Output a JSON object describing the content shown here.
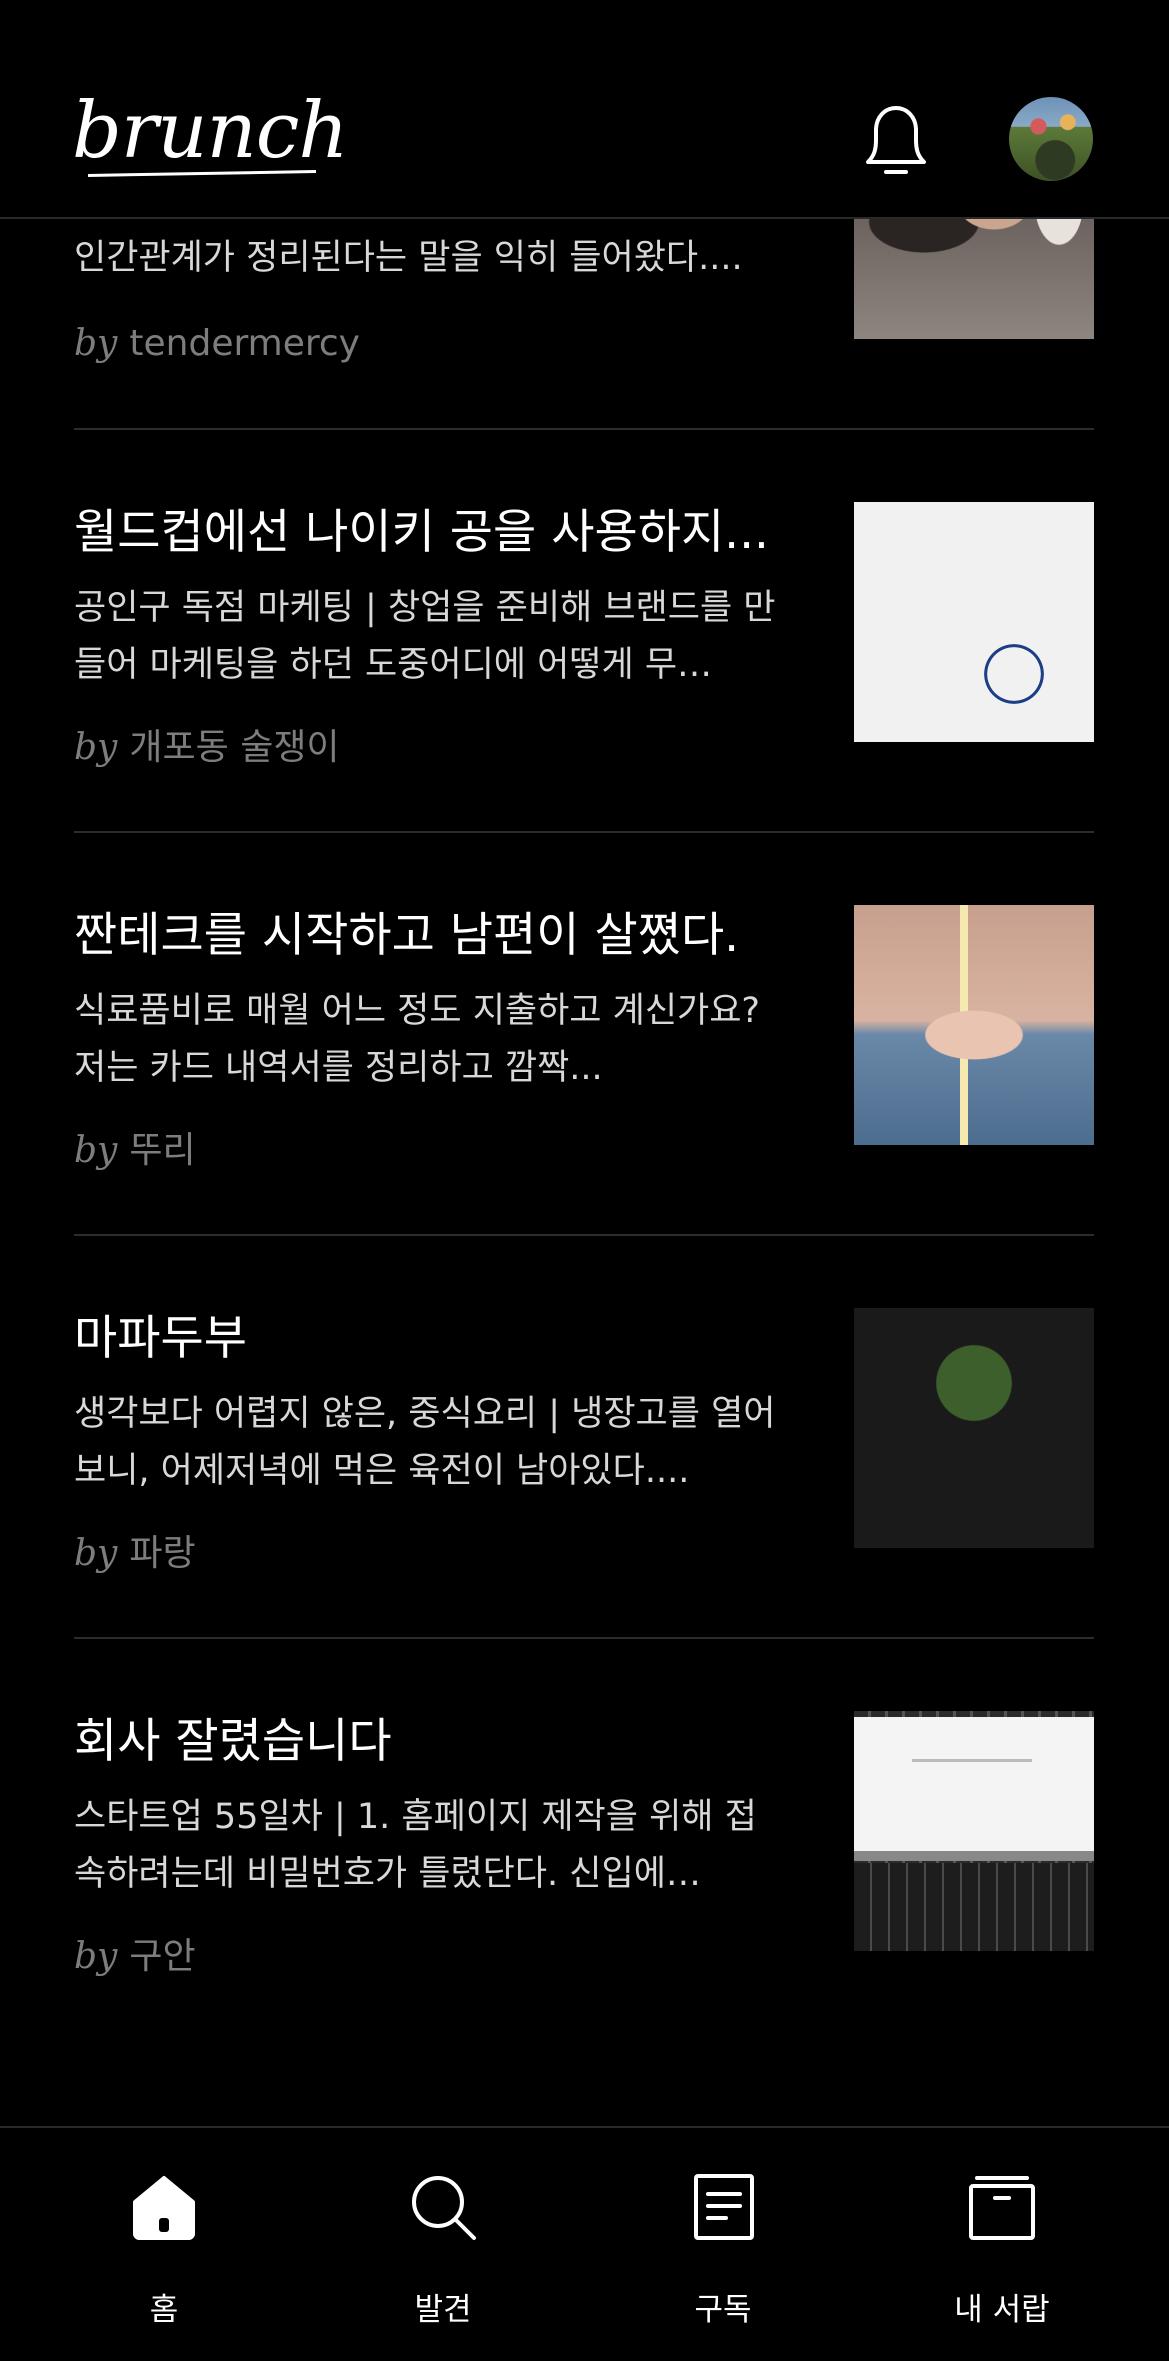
{
  "header": {
    "logo": "brunch",
    "notifications_icon": "bell-icon",
    "profile_icon": "avatar"
  },
  "articles": [
    {
      "title": "",
      "description": "인간관계가 정리된다는 말을 익히 들어왔다....",
      "author": "tendermercy",
      "by": "by"
    },
    {
      "title": "월드컵에선 나이키 공을 사용하지...",
      "description": "공인구 독점 마케팅 | 창업을 준비해 브랜드를 만들어 마케팅을 하던 도중어디에 어떻게 무…",
      "author": "개포동 술쟁이",
      "by": "by"
    },
    {
      "title": "짠테크를 시작하고 남편이 살쪘다.",
      "description": "식료품비로 매월 어느 정도 지출하고 계신가요? 저는 카드 내역서를 정리하고 깜짝...",
      "author": "뚜리",
      "by": "by"
    },
    {
      "title": "마파두부",
      "description": "생각보다 어렵지 않은, 중식요리 | 냉장고를 열어보니, 어제저녁에 먹은 육전이 남아있다....",
      "author": "파랑",
      "by": "by"
    },
    {
      "title": "회사 잘렸습니다",
      "description": "스타트업 55일차 | 1. 홈페이지 제작을 위해 접속하려는데 비밀번호가 틀렸단다. 신입에…",
      "author": "구안",
      "by": "by"
    }
  ],
  "nav": {
    "home": "홈",
    "discover": "발견",
    "subscribe": "구독",
    "library": "내 서랍"
  },
  "colors": {
    "background": "#000000",
    "text": "#ffffff",
    "secondary_text": "#d8d8d8",
    "byline": "#7d7d7d",
    "divider": "#2c2c2c"
  }
}
